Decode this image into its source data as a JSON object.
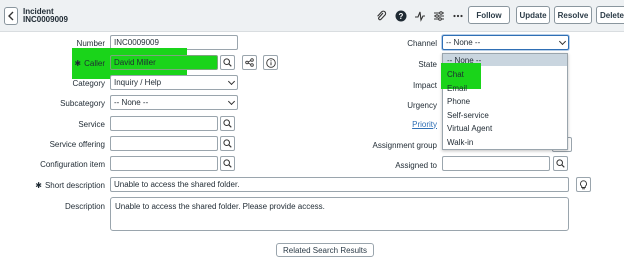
{
  "header": {
    "record_type": "Incident",
    "record_number": "INC0009009",
    "buttons": {
      "follow": "Follow",
      "update": "Update",
      "resolve": "Resolve",
      "delete": "Delete"
    }
  },
  "form": {
    "number": {
      "label": "Number",
      "value": "INC0009009"
    },
    "caller": {
      "label": "Caller",
      "value": "David Miller"
    },
    "category": {
      "label": "Category",
      "value": "Inquiry / Help"
    },
    "subcategory": {
      "label": "Subcategory",
      "value": "-- None --"
    },
    "service": {
      "label": "Service",
      "value": ""
    },
    "service_offering": {
      "label": "Service offering",
      "value": ""
    },
    "configuration_item": {
      "label": "Configuration item",
      "value": ""
    },
    "short_description": {
      "label": "Short description",
      "value": "Unable to access the shared folder."
    },
    "description": {
      "label": "Description",
      "value": "Unable to access the shared folder. Please provide access."
    },
    "channel": {
      "label": "Channel",
      "value": "-- None --"
    },
    "state": {
      "label": "State"
    },
    "impact": {
      "label": "Impact"
    },
    "urgency": {
      "label": "Urgency"
    },
    "priority": {
      "label": "Priority"
    },
    "assignment_group": {
      "label": "Assignment group",
      "value": ""
    },
    "assigned_to": {
      "label": "Assigned to",
      "value": ""
    }
  },
  "mandatory_marker": "✱",
  "channel_dropdown": {
    "options": [
      "-- None --",
      "Chat",
      "Email",
      "Phone",
      "Self-service",
      "Virtual Agent",
      "Walk-in"
    ]
  },
  "related_search": "Related Search Results",
  "colors": {
    "highlight": "#1ad41a",
    "accent": "#2f6fb5"
  }
}
